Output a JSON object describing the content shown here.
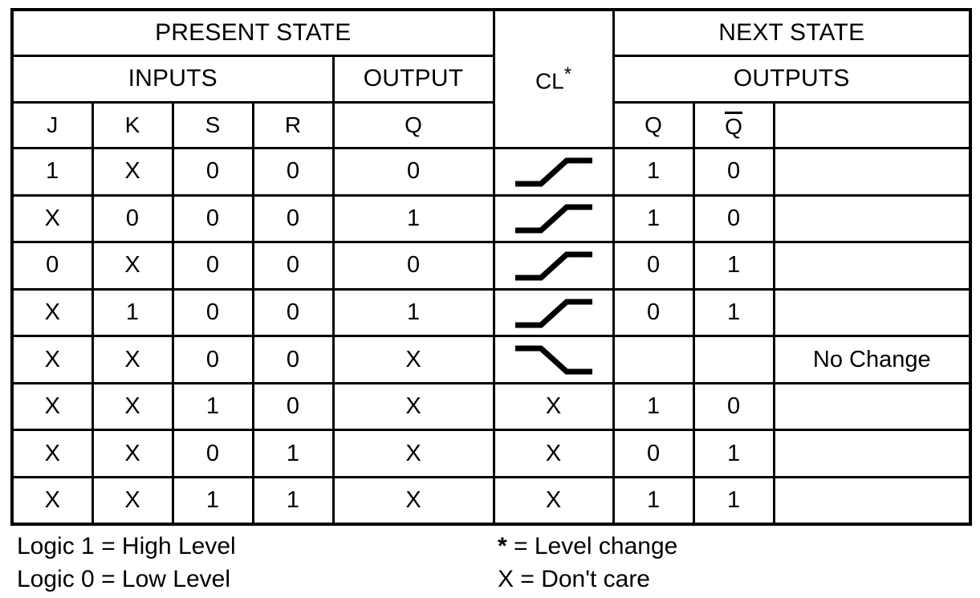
{
  "table": {
    "group_headers": {
      "present_state": "PRESENT STATE",
      "next_state": "NEXT STATE"
    },
    "sub_headers": {
      "inputs": "INPUTS",
      "output": "OUTPUT",
      "outputs": "OUTPUTS"
    },
    "column_headers": {
      "j": "J",
      "k": "K",
      "s": "S",
      "r": "R",
      "q_present": "Q",
      "cl": "CL",
      "cl_star": "*",
      "q_next": "Q",
      "q_not_next": "Q",
      "notes": ""
    },
    "rows": [
      {
        "j": "1",
        "k": "X",
        "s": "0",
        "r": "0",
        "q_present": "0",
        "cl": "rising-edge",
        "q_next": "1",
        "q_not_next": "0",
        "notes": ""
      },
      {
        "j": "X",
        "k": "0",
        "s": "0",
        "r": "0",
        "q_present": "1",
        "cl": "rising-edge",
        "q_next": "1",
        "q_not_next": "0",
        "notes": ""
      },
      {
        "j": "0",
        "k": "X",
        "s": "0",
        "r": "0",
        "q_present": "0",
        "cl": "rising-edge",
        "q_next": "0",
        "q_not_next": "1",
        "notes": ""
      },
      {
        "j": "X",
        "k": "1",
        "s": "0",
        "r": "0",
        "q_present": "1",
        "cl": "rising-edge",
        "q_next": "0",
        "q_not_next": "1",
        "notes": ""
      },
      {
        "j": "X",
        "k": "X",
        "s": "0",
        "r": "0",
        "q_present": "X",
        "cl": "falling-edge",
        "q_next": "",
        "q_not_next": "",
        "notes": "No Change"
      },
      {
        "j": "X",
        "k": "X",
        "s": "1",
        "r": "0",
        "q_present": "X",
        "cl": "X",
        "q_next": "1",
        "q_not_next": "0",
        "notes": ""
      },
      {
        "j": "X",
        "k": "X",
        "s": "0",
        "r": "1",
        "q_present": "X",
        "cl": "X",
        "q_next": "0",
        "q_not_next": "1",
        "notes": ""
      },
      {
        "j": "X",
        "k": "X",
        "s": "1",
        "r": "1",
        "q_present": "X",
        "cl": "X",
        "q_next": "1",
        "q_not_next": "1",
        "notes": ""
      }
    ]
  },
  "legend": {
    "left": [
      "Logic 1 = High Level",
      "Logic 0 = Low Level"
    ],
    "right_star_symbol": "*",
    "right_star_text": " = Level change",
    "right_x_text": "X = Don't care"
  },
  "colors": {
    "ink": "#000000",
    "paper": "#ffffff"
  }
}
